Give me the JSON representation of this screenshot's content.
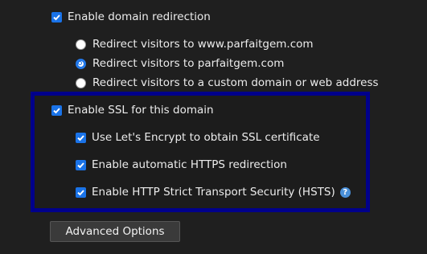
{
  "domain_redirection": {
    "label": "Enable domain redirection",
    "checked": true,
    "options": [
      {
        "label": "Redirect visitors to www.parfaitgem.com",
        "selected": false
      },
      {
        "label": "Redirect visitors to parfaitgem.com",
        "selected": true
      },
      {
        "label": "Redirect visitors to a custom domain or web address",
        "selected": false
      }
    ]
  },
  "ssl": {
    "label": "Enable SSL for this domain",
    "checked": true,
    "options": [
      {
        "label": "Use Let's Encrypt to obtain SSL certificate",
        "checked": true
      },
      {
        "label": "Enable automatic HTTPS redirection",
        "checked": true
      },
      {
        "label": "Enable HTTP Strict Transport Security (HSTS)",
        "checked": true,
        "help_icon": "help-icon",
        "help_glyph": "?"
      }
    ]
  },
  "advanced_button": {
    "label": "Advanced Options"
  },
  "colors": {
    "accent": "#1a73e8",
    "highlight_border": "#00008b",
    "background": "#1f1f1f"
  }
}
